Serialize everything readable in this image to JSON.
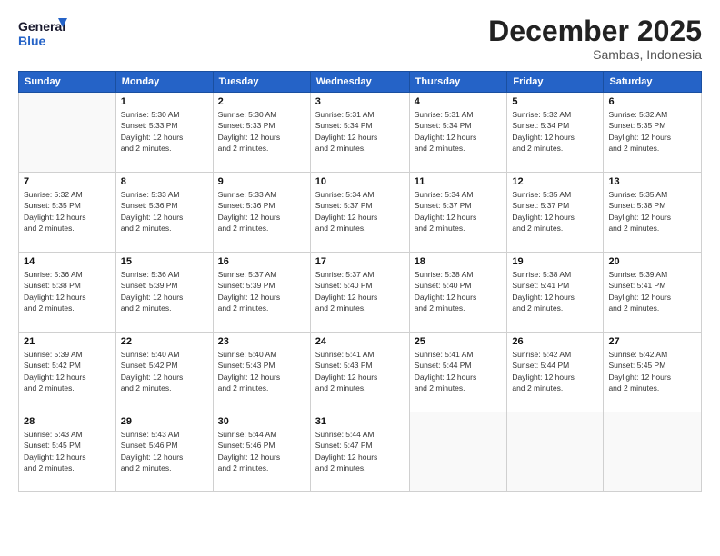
{
  "logo": {
    "line1": "General",
    "line2": "Blue"
  },
  "title": "December 2025",
  "subtitle": "Sambas, Indonesia",
  "weekdays": [
    "Sunday",
    "Monday",
    "Tuesday",
    "Wednesday",
    "Thursday",
    "Friday",
    "Saturday"
  ],
  "weeks": [
    [
      {
        "day": "",
        "info": ""
      },
      {
        "day": "1",
        "info": "Sunrise: 5:30 AM\nSunset: 5:33 PM\nDaylight: 12 hours\nand 2 minutes."
      },
      {
        "day": "2",
        "info": "Sunrise: 5:30 AM\nSunset: 5:33 PM\nDaylight: 12 hours\nand 2 minutes."
      },
      {
        "day": "3",
        "info": "Sunrise: 5:31 AM\nSunset: 5:34 PM\nDaylight: 12 hours\nand 2 minutes."
      },
      {
        "day": "4",
        "info": "Sunrise: 5:31 AM\nSunset: 5:34 PM\nDaylight: 12 hours\nand 2 minutes."
      },
      {
        "day": "5",
        "info": "Sunrise: 5:32 AM\nSunset: 5:34 PM\nDaylight: 12 hours\nand 2 minutes."
      },
      {
        "day": "6",
        "info": "Sunrise: 5:32 AM\nSunset: 5:35 PM\nDaylight: 12 hours\nand 2 minutes."
      }
    ],
    [
      {
        "day": "7",
        "info": "Sunrise: 5:32 AM\nSunset: 5:35 PM\nDaylight: 12 hours\nand 2 minutes."
      },
      {
        "day": "8",
        "info": "Sunrise: 5:33 AM\nSunset: 5:36 PM\nDaylight: 12 hours\nand 2 minutes."
      },
      {
        "day": "9",
        "info": "Sunrise: 5:33 AM\nSunset: 5:36 PM\nDaylight: 12 hours\nand 2 minutes."
      },
      {
        "day": "10",
        "info": "Sunrise: 5:34 AM\nSunset: 5:37 PM\nDaylight: 12 hours\nand 2 minutes."
      },
      {
        "day": "11",
        "info": "Sunrise: 5:34 AM\nSunset: 5:37 PM\nDaylight: 12 hours\nand 2 minutes."
      },
      {
        "day": "12",
        "info": "Sunrise: 5:35 AM\nSunset: 5:37 PM\nDaylight: 12 hours\nand 2 minutes."
      },
      {
        "day": "13",
        "info": "Sunrise: 5:35 AM\nSunset: 5:38 PM\nDaylight: 12 hours\nand 2 minutes."
      }
    ],
    [
      {
        "day": "14",
        "info": "Sunrise: 5:36 AM\nSunset: 5:38 PM\nDaylight: 12 hours\nand 2 minutes."
      },
      {
        "day": "15",
        "info": "Sunrise: 5:36 AM\nSunset: 5:39 PM\nDaylight: 12 hours\nand 2 minutes."
      },
      {
        "day": "16",
        "info": "Sunrise: 5:37 AM\nSunset: 5:39 PM\nDaylight: 12 hours\nand 2 minutes."
      },
      {
        "day": "17",
        "info": "Sunrise: 5:37 AM\nSunset: 5:40 PM\nDaylight: 12 hours\nand 2 minutes."
      },
      {
        "day": "18",
        "info": "Sunrise: 5:38 AM\nSunset: 5:40 PM\nDaylight: 12 hours\nand 2 minutes."
      },
      {
        "day": "19",
        "info": "Sunrise: 5:38 AM\nSunset: 5:41 PM\nDaylight: 12 hours\nand 2 minutes."
      },
      {
        "day": "20",
        "info": "Sunrise: 5:39 AM\nSunset: 5:41 PM\nDaylight: 12 hours\nand 2 minutes."
      }
    ],
    [
      {
        "day": "21",
        "info": "Sunrise: 5:39 AM\nSunset: 5:42 PM\nDaylight: 12 hours\nand 2 minutes."
      },
      {
        "day": "22",
        "info": "Sunrise: 5:40 AM\nSunset: 5:42 PM\nDaylight: 12 hours\nand 2 minutes."
      },
      {
        "day": "23",
        "info": "Sunrise: 5:40 AM\nSunset: 5:43 PM\nDaylight: 12 hours\nand 2 minutes."
      },
      {
        "day": "24",
        "info": "Sunrise: 5:41 AM\nSunset: 5:43 PM\nDaylight: 12 hours\nand 2 minutes."
      },
      {
        "day": "25",
        "info": "Sunrise: 5:41 AM\nSunset: 5:44 PM\nDaylight: 12 hours\nand 2 minutes."
      },
      {
        "day": "26",
        "info": "Sunrise: 5:42 AM\nSunset: 5:44 PM\nDaylight: 12 hours\nand 2 minutes."
      },
      {
        "day": "27",
        "info": "Sunrise: 5:42 AM\nSunset: 5:45 PM\nDaylight: 12 hours\nand 2 minutes."
      }
    ],
    [
      {
        "day": "28",
        "info": "Sunrise: 5:43 AM\nSunset: 5:45 PM\nDaylight: 12 hours\nand 2 minutes."
      },
      {
        "day": "29",
        "info": "Sunrise: 5:43 AM\nSunset: 5:46 PM\nDaylight: 12 hours\nand 2 minutes."
      },
      {
        "day": "30",
        "info": "Sunrise: 5:44 AM\nSunset: 5:46 PM\nDaylight: 12 hours\nand 2 minutes."
      },
      {
        "day": "31",
        "info": "Sunrise: 5:44 AM\nSunset: 5:47 PM\nDaylight: 12 hours\nand 2 minutes."
      },
      {
        "day": "",
        "info": ""
      },
      {
        "day": "",
        "info": ""
      },
      {
        "day": "",
        "info": ""
      }
    ]
  ]
}
